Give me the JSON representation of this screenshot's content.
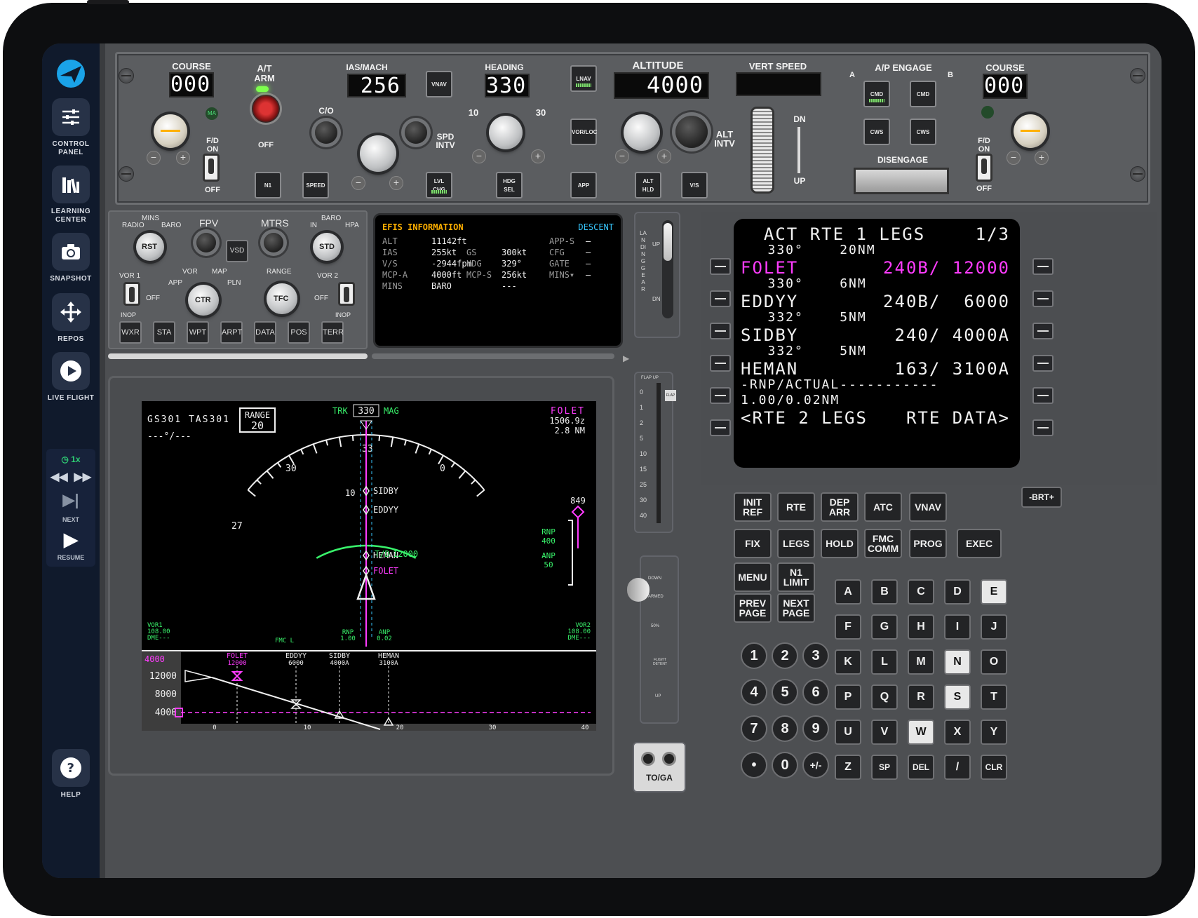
{
  "sidebar": {
    "items": [
      {
        "label": "CONTROL PANEL",
        "icon": "sliders-icon"
      },
      {
        "label": "LEARNING CENTER",
        "icon": "books-icon"
      },
      {
        "label": "SNAPSHOT",
        "icon": "camera-icon"
      },
      {
        "label": "REPOS",
        "icon": "move-icon"
      },
      {
        "label": "LIVE FLIGHT",
        "icon": "play-icon"
      }
    ],
    "sim_speed": "1x",
    "next_label": "NEXT",
    "resume_label": "RESUME",
    "help_label": "HELP"
  },
  "mcp": {
    "course_left": {
      "label": "COURSE",
      "value": "000"
    },
    "at_arm": {
      "label": "A/T\nARM",
      "off": "OFF"
    },
    "ma_label": "MA",
    "fd_left": {
      "label": "F/D\nON",
      "off": "OFF"
    },
    "ias_mach": {
      "label": "IAS/MACH",
      "value": "256"
    },
    "co_label": "C/O",
    "spd_intv": "SPD\nINTV",
    "heading": {
      "label": "HEADING",
      "value": "330",
      "left": "10",
      "right": "30"
    },
    "altitude": {
      "label": "ALTITUDE",
      "value": "4000"
    },
    "alt_intv": "ALT\nINTV",
    "vert_speed": {
      "label": "VERT SPEED",
      "value": ""
    },
    "dn": "DN",
    "up": "UP",
    "ap_engage": {
      "label": "A/P ENGAGE",
      "a": "A",
      "b": "B"
    },
    "disengage": "DISENGAGE",
    "course_right": {
      "label": "COURSE",
      "value": "000"
    },
    "fd_right": {
      "label": "F/D\nON",
      "off": "OFF"
    },
    "buttons": {
      "vnav": "VNAV",
      "lnav": "LNAV",
      "vorloc": "VOR/LOC",
      "n1": "N1",
      "speed": "SPEED",
      "lvlchg": "LVL\nCHG",
      "hdgsel": "HDG\nSEL",
      "app": "APP",
      "althld": "ALT\nHLD",
      "vs": "V/S",
      "cmd_a": "CMD",
      "cmd_b": "CMD",
      "cws_a": "CWS",
      "cws_b": "CWS"
    }
  },
  "efis_control": {
    "mins": "MINS",
    "radio": "RADIO",
    "baro_l": "BARO",
    "rst": "RST",
    "fpv": "FPV",
    "mtrs": "MTRS",
    "in": "IN",
    "baro_r": "BARO",
    "hpa": "HPA",
    "std": "STD",
    "vsd": "VSD",
    "vor1": "VOR 1",
    "vor2": "VOR 2",
    "off_l": "OFF",
    "off_r": "OFF",
    "inop_l": "INOP",
    "inop_r": "INOP",
    "vor": "VOR",
    "map": "MAP",
    "app": "APP",
    "pln": "PLN",
    "ctr": "CTR",
    "range": "RANGE",
    "tfc": "TFC",
    "buttons": [
      "WXR",
      "STA",
      "WPT",
      "ARPT",
      "DATA",
      "POS",
      "TERR"
    ]
  },
  "efis_info": {
    "title": "EFIS INFORMATION",
    "phase": "DESCENT",
    "rows": [
      [
        "ALT",
        "11142ft",
        "",
        "",
        "APP-S",
        "–"
      ],
      [
        "IAS",
        "255kt",
        "GS",
        "300kt",
        "CFG",
        "–"
      ],
      [
        "V/S",
        "-2944fpm",
        "HDG",
        "329°",
        "GATE",
        "–"
      ],
      [
        "MCP-A",
        "4000ft",
        "MCP-S",
        "256kt",
        "MINS▾",
        "–"
      ],
      [
        "MINS",
        "BARO",
        "",
        "---",
        "",
        ""
      ]
    ]
  },
  "gear": {
    "label": "LANDING GEAR",
    "up": "UP",
    "dn": "DN"
  },
  "nd": {
    "gs_tas": "GS301 TAS301",
    "wind": "---°/---",
    "range_label": "RANGE",
    "range_value": "20",
    "trk": "TRK",
    "hdg": "330",
    "mag": "MAG",
    "wpt": "FOLET",
    "wpt_time": "1506.9z",
    "wpt_dist": "2.8 NM",
    "ticks": [
      "30",
      "33",
      "0",
      "27"
    ],
    "arc_label": "10",
    "waypoints": [
      "SIDBY",
      "EDDYY",
      "HEMAN",
      "FOLET"
    ],
    "tod": "T/D",
    "alt_tag": "12000",
    "vsi": "849",
    "rnp_label": "RNP",
    "rnp_value": "400",
    "anp_label": "ANP",
    "anp_value": "50",
    "vor1": "VOR1\n108.00\nDME---",
    "vor2": "VOR2\n108.00\nDME---",
    "fmc": "FMC L",
    "rnp_small": "RNP\n1.00",
    "anp_small": "ANP\n0.02",
    "vsd_alt": "4000",
    "vsd_y": [
      "12000",
      "8000",
      "4000"
    ],
    "vsd_x": [
      "0",
      "10",
      "20",
      "30",
      "40"
    ],
    "vsd_wpts": [
      {
        "name": "FOLET",
        "alt": "12000"
      },
      {
        "name": "EDDYY",
        "alt": "6000"
      },
      {
        "name": "SIDBY",
        "alt": "4000A"
      },
      {
        "name": "HEMAN",
        "alt": "3100A"
      }
    ]
  },
  "flaps": {
    "label": "FLAP UP",
    "marks": [
      "0",
      "1",
      "2",
      "5",
      "10",
      "15",
      "25",
      "30",
      "40"
    ],
    "tag": "FLAP"
  },
  "speedbrake": {
    "down": "DOWN",
    "armed": "ARMED",
    "fifty": "50%",
    "detent": "FLIGHT DETENT",
    "up": "UP"
  },
  "toga": "TO/GA",
  "cdu": {
    "lines": [
      {
        "l": "  ACT RTE 1 LEGS",
        "r": "1/3",
        "color": "w",
        "small": false
      },
      {
        "l": "   330°    20NM",
        "r": "",
        "color": "w",
        "small": true
      },
      {
        "l": "FOLET",
        "r": "240B/ 12000",
        "color": "m",
        "small": false
      },
      {
        "l": "   330°    6NM",
        "r": "",
        "color": "w",
        "small": true
      },
      {
        "l": "EDDYY",
        "r": "240B/  6000",
        "color": "w",
        "small": false
      },
      {
        "l": "   332°    5NM",
        "r": "",
        "color": "w",
        "small": true
      },
      {
        "l": "SIDBY",
        "r": "240/ 4000A",
        "color": "w",
        "small": false
      },
      {
        "l": "   332°    5NM",
        "r": "",
        "color": "w",
        "small": true
      },
      {
        "l": "HEMAN",
        "r": "163/ 3100A",
        "color": "w",
        "small": false
      },
      {
        "l": "-RNP/ACTUAL-----------",
        "r": "",
        "color": "w",
        "small": true
      },
      {
        "l": "1.00/0.02NM",
        "r": "",
        "color": "w",
        "small": true
      },
      {
        "l": "<RTE 2 LEGS",
        "r": "RTE DATA>",
        "color": "w",
        "small": false
      }
    ],
    "brt": "-BRT+",
    "func_keys": [
      "INIT\nREF",
      "RTE",
      "DEP\nARR",
      "ATC",
      "VNAV",
      "FIX",
      "LEGS",
      "HOLD",
      "FMC\nCOMM",
      "PROG",
      "EXEC",
      "MENU",
      "N1\nLIMIT",
      "PREV\nPAGE",
      "NEXT\nPAGE"
    ],
    "alpha": [
      "A",
      "B",
      "C",
      "D",
      "E",
      "F",
      "G",
      "H",
      "I",
      "J",
      "K",
      "L",
      "M",
      "N",
      "O",
      "P",
      "Q",
      "R",
      "S",
      "T",
      "U",
      "V",
      "W",
      "X",
      "Y",
      "Z",
      "SP",
      "DEL",
      "/",
      "CLR"
    ],
    "lit_alpha": [
      "E",
      "N",
      "S",
      "W"
    ],
    "numeric": [
      "1",
      "2",
      "3",
      "4",
      "5",
      "6",
      "7",
      "8",
      "9",
      "•",
      "0",
      "+/-"
    ]
  },
  "colors": {
    "magenta": "#ff3cff",
    "green": "#39f36b",
    "cyan": "#37c8ff",
    "amber": "#ffb000"
  }
}
